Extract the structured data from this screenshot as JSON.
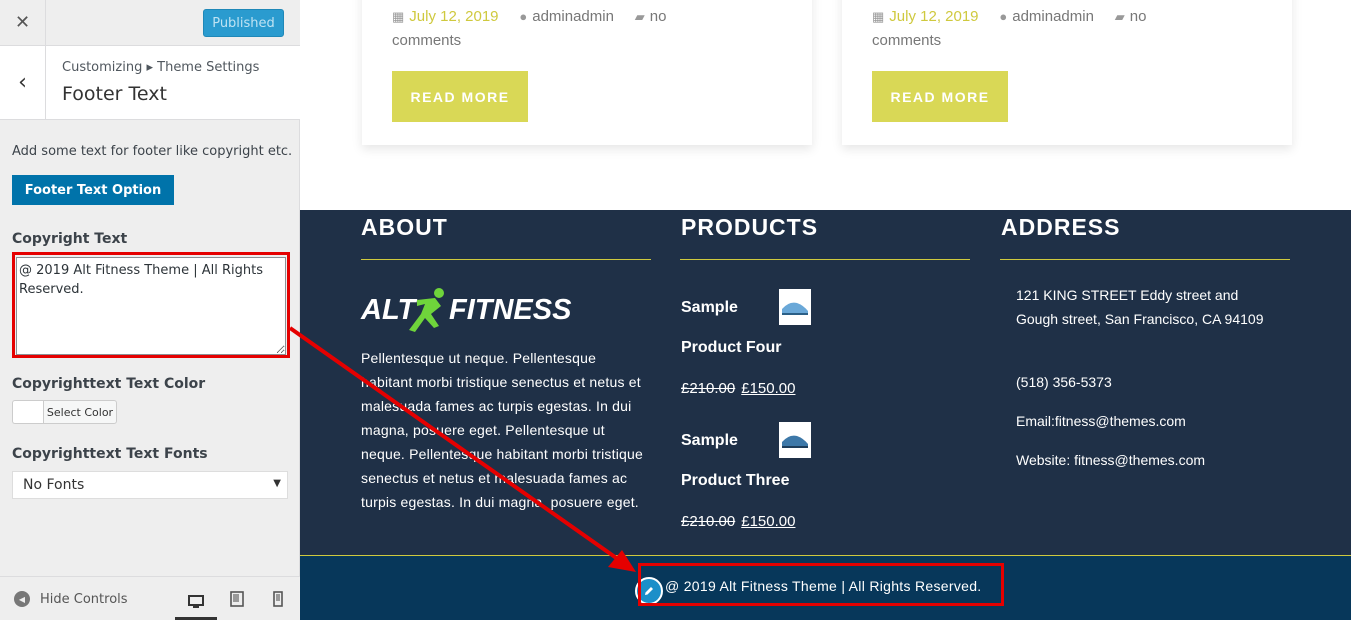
{
  "customizer": {
    "close_icon": "close-icon",
    "publish_button": "Published",
    "breadcrumb": "Customizing ▸ Theme Settings",
    "section_title": "Footer Text",
    "description": "Add some text for footer like copyright etc.",
    "footer_option_button": "Footer Text Option",
    "copyright_label": "Copyright Text",
    "copyright_value": "@ 2019 Alt Fitness Theme | All Rights Reserved.",
    "color_label": "Copyrighttext Text Color",
    "select_color_button": "Select Color",
    "fonts_label": "Copyrighttext Text Fonts",
    "fonts_value": "No Fonts",
    "hide_controls": "Hide Controls"
  },
  "preview": {
    "posts": [
      {
        "date": "July 12, 2019",
        "author": "adminadmin",
        "comments_a": "no",
        "comments_b": "comments",
        "read_more": "READ MORE"
      },
      {
        "date": "July 12, 2019",
        "author": "adminadmin",
        "comments_a": "no",
        "comments_b": "comments",
        "read_more": "READ MORE"
      }
    ],
    "footer": {
      "about_title": "ABOUT",
      "logo_a": "ALT",
      "logo_b": "FITNESS",
      "about_text": "Pellentesque ut neque. Pellentesque habitant morbi tristique senectus et netus et malesuada fames ac turpis egestas. In dui magna, posuere eget. Pellentesque ut neque. Pellentesque habitant morbi tristique senectus et netus et malesuada fames ac turpis egestas. In dui magna, posuere eget.",
      "products_title": "PRODUCTS",
      "products": [
        {
          "name_a": "Sample",
          "name_b": "Product Four",
          "old_price": "£210.00",
          "new_price": "£150.00"
        },
        {
          "name_a": "Sample",
          "name_b": "Product Three",
          "old_price": "£210.00",
          "new_price": "£150.00"
        }
      ],
      "address_title": "ADDRESS",
      "address": "121 KING STREET Eddy street and Gough street, San Francisco, CA 94109",
      "phone": "(518) 356-5373",
      "email": "Email:fitness@themes.com",
      "website": "Website: fitness@themes.com",
      "copyright": "@ 2019 Alt Fitness Theme | All Rights Reserved."
    }
  },
  "colors": {
    "accent": "#cfc93e",
    "footer_bg": "#1f3047",
    "bottom_bar_bg": "#07375a",
    "customizer_button": "#0073aa",
    "highlight": "#e50000"
  }
}
